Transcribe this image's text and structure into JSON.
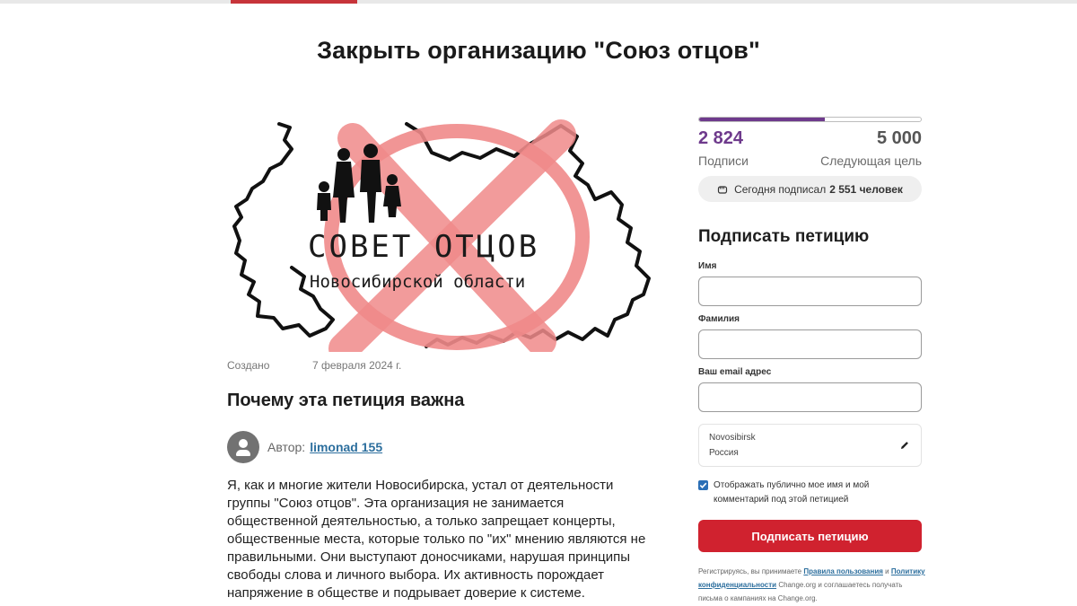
{
  "page": {
    "title": "Закрыть организацию \"Союз отцов\""
  },
  "hero_image": {
    "headline": "СОВЕТ ОТЦОВ",
    "subline": "Новосибирской области"
  },
  "meta": {
    "created_label": "Создано",
    "created_date": "7 февраля 2024 г."
  },
  "section": {
    "why_title": "Почему эта петиция важна"
  },
  "author": {
    "prefix": "Автор:",
    "name": "limonad 155"
  },
  "body": {
    "text": "Я, как и многие жители Новосибирска, устал от деятельности группы \"Союз отцов\". Эта организация не занимается общественной деятельностью, а только запрещает концерты, общественные места, которые только по \"их\" мнению являются не правильными. Они выступают доносчиками, нарушая принципы свободы слова и личного выбора. Их активность порождает напряжение в обществе и подрывает доверие к системе."
  },
  "stats": {
    "signatures": "2 824",
    "signatures_label": "Подписи",
    "goal": "5 000",
    "goal_label": "Следующая цель",
    "progress_fraction": 0.565,
    "today_prefix": "Сегодня подписал",
    "today_count": "2 551 человек"
  },
  "form": {
    "heading": "Подписать петицию",
    "first_name_label": "Имя",
    "last_name_label": "Фамилия",
    "email_label": "Ваш email адрес",
    "city": "Novosibirsk",
    "country": "Россия",
    "checkbox_text": "Отображать публично мое имя и мой комментарий под этой петицией",
    "checkbox_checked": true,
    "submit_label": "Подписать петицию"
  },
  "terms": {
    "part1": "Регистрируясь, вы принимаете",
    "link1": "Правила пользования",
    "part2": "и",
    "link2": "Политику конфиденциальности",
    "part3": "Change.org и соглашаетесь получать письма о кампаниях на Change.org."
  },
  "colors": {
    "brand_red": "#d0222f",
    "progress_purple": "#6e3a8c",
    "link_blue": "#2d6f9e",
    "checkbox_blue": "#2b6fb6",
    "cross_red": "#f08a8a"
  },
  "icons": {
    "today": "fist-icon",
    "edit": "pencil-icon",
    "avatar": "user-avatar-icon",
    "check": "checkmark-icon"
  }
}
